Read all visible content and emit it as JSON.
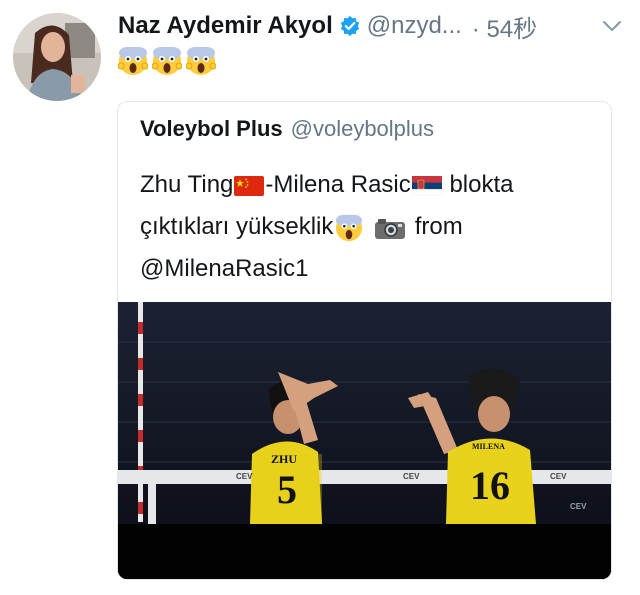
{
  "tweet": {
    "author": {
      "display_name": "Naz Aydemir Akyol",
      "handle": "@nzyd...",
      "verified_icon": "verified-badge-icon"
    },
    "timestamp": "· 54秒",
    "emoji_reaction": [
      "scream-emoji",
      "scream-emoji",
      "scream-emoji"
    ],
    "quoted": {
      "display_name": "Voleybol Plus",
      "handle": "@voleybolplus",
      "text": {
        "line1_part1": "Zhu Ting",
        "line1_part2": "-Milena Rasic",
        "line1_part3": "blokta",
        "line2_part1": "çıktıkları yükseklik",
        "line2_part2": "from",
        "line3": "@MilenaRasic1"
      },
      "media": {
        "net_label_1": "CEV",
        "net_label_2": "CEV",
        "net_label_3": "CEV",
        "jersey_left_name": "ZHU",
        "jersey_left_number": "5",
        "jersey_right_name": "MILENA",
        "jersey_right_number": "16",
        "corner_logo": "CEV"
      }
    }
  },
  "colors": {
    "name_text": "#14171a",
    "secondary_text": "#657786",
    "verified_blue": "#1da1f2",
    "border": "#e1e8ed",
    "jersey_yellow": "#e9d21c"
  }
}
